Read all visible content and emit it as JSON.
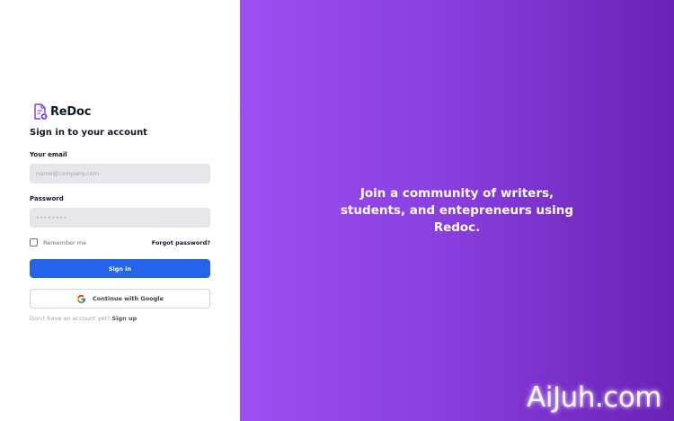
{
  "brand": {
    "name": "ReDoc",
    "icon": "document-logo-icon"
  },
  "login": {
    "title": "Sign in to your account",
    "email_label": "Your email",
    "email_placeholder": "name@company.com",
    "password_label": "Password",
    "password_placeholder": "••••••••",
    "remember_label": "Remember me",
    "forgot_label": "Forgot password?",
    "signin_label": "Sign in",
    "google_label": "Continue with Google",
    "signup_prompt": "Don't have an account yet?",
    "signup_link": "Sign up"
  },
  "hero": {
    "line1": "Join a community of writers,",
    "line2": "students, and entepreneurs using",
    "line3": "Redoc."
  },
  "watermark": "AiJuh.com",
  "colors": {
    "primary": "#2563eb",
    "gradient_start": "#9d4ff0",
    "gradient_end": "#6a22b4",
    "logo": "#7c3aed"
  }
}
